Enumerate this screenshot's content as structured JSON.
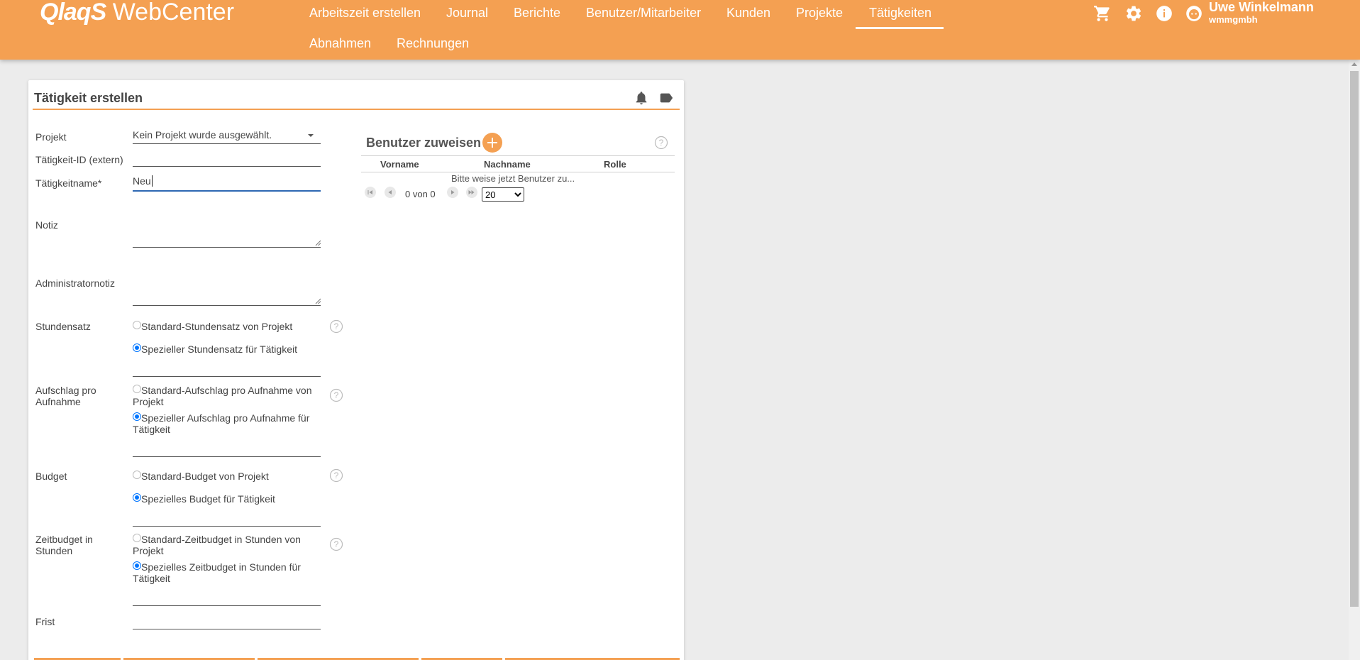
{
  "app": {
    "logo_bold": "QlaqS",
    "logo_light": " WebCenter"
  },
  "nav": {
    "items": [
      {
        "label": "Arbeitszeit erstellen"
      },
      {
        "label": "Journal"
      },
      {
        "label": "Berichte"
      },
      {
        "label": "Benutzer/Mitarbeiter"
      },
      {
        "label": "Kunden"
      },
      {
        "label": "Projekte"
      },
      {
        "label": "Tätigkeiten",
        "active": true
      },
      {
        "label": "Abnahmen"
      },
      {
        "label": "Rechnungen"
      }
    ]
  },
  "user": {
    "name": "Uwe Winkelmann",
    "company": "wmmgmbh"
  },
  "topbar_icons": [
    "cart-icon",
    "gear-icon",
    "info-icon",
    "user-face-icon"
  ],
  "form": {
    "title": "Tätigkeit erstellen",
    "header_icons": [
      "bell-icon",
      "tag-icon"
    ],
    "project": {
      "label": "Projekt",
      "value": "Kein Projekt wurde ausgewählt."
    },
    "external_id": {
      "label": "Tätigkeit-ID (extern)",
      "value": ""
    },
    "name": {
      "label": "Tätigkeitname*",
      "value": "Neu"
    },
    "note": {
      "label": "Notiz",
      "value": ""
    },
    "admin_note": {
      "label": "Administratornotiz",
      "value": ""
    },
    "hourly_rate": {
      "label": "Stundensatz",
      "option_default": "Standard-Stundensatz von Projekt",
      "option_special": "Spezieller Stundensatz für Tätigkeit",
      "selected": "special"
    },
    "surcharge": {
      "label_line1": "Aufschlag pro",
      "label_line2": "Aufnahme",
      "option_default_line1": "Standard-Aufschlag pro Aufnahme von",
      "option_default_line2": "Projekt",
      "option_special_line1": "Spezieller Aufschlag pro Aufnahme für",
      "option_special_line2": "Tätigkeit",
      "selected": "special"
    },
    "budget": {
      "label": "Budget",
      "option_default": "Standard-Budget von Projekt",
      "option_special": "Spezielles Budget für Tätigkeit",
      "selected": "special"
    },
    "time_budget": {
      "label_line1": "Zeitbudget in",
      "label_line2": "Stunden",
      "option_default_line1": "Standard-Zeitbudget in Stunden von",
      "option_default_line2": "Projekt",
      "option_special_line1": "Spezielles Zeitbudget in Stunden für",
      "option_special_line2": "Tätigkeit",
      "selected": "special"
    },
    "deadline": {
      "label": "Frist",
      "value": ""
    }
  },
  "assign_users": {
    "title": "Benutzer zuweisen",
    "columns": [
      "Vorname",
      "Nachname",
      "Rolle"
    ],
    "empty_message": "Bitte weise jetzt Benutzer zu...",
    "pagination_text": "0 von 0",
    "page_size": "20",
    "page_size_options": [
      "20"
    ]
  },
  "colors": {
    "accent": "#f4a052",
    "radio_selected": "#0075ff",
    "focus_line": "#2d68b3"
  }
}
